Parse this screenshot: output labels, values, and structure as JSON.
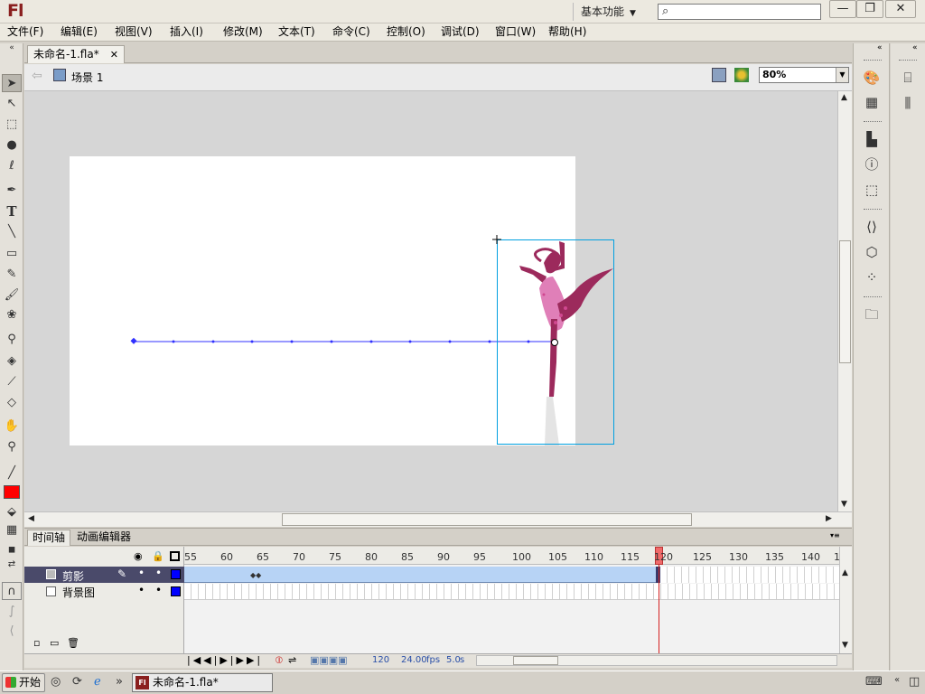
{
  "app": {
    "logo": "Fl",
    "workspace": "基本功能",
    "search_placeholder": ""
  },
  "window_controls": {
    "minimize": "—",
    "restore": "❐",
    "close": "✕"
  },
  "menu": [
    "文件(F)",
    "编辑(E)",
    "视图(V)",
    "插入(I)",
    "修改(M)",
    "文本(T)",
    "命令(C)",
    "控制(O)",
    "调试(D)",
    "窗口(W)",
    "帮助(H)"
  ],
  "document": {
    "tab_title": "未命名-1.fla*",
    "scene_label": "场景 1",
    "zoom": "80%"
  },
  "timeline": {
    "tabs": [
      "时间轴",
      "动画编辑器"
    ],
    "layers": [
      {
        "name": "剪影",
        "selected": true
      },
      {
        "name": "背景图",
        "selected": false
      }
    ],
    "frame_labels": [
      "55",
      "60",
      "65",
      "70",
      "75",
      "80",
      "85",
      "90",
      "95",
      "100",
      "105",
      "110",
      "115",
      "120",
      "125",
      "130",
      "135",
      "140",
      "1"
    ],
    "current_frame": "120",
    "fps": "24.00",
    "fps_unit": "fps",
    "elapsed": "5.0",
    "elapsed_unit": "s"
  },
  "taskbar": {
    "start": "开始",
    "task": "未命名-1.fla*",
    "more": "»"
  },
  "colors": {
    "stroke": "#000000",
    "fill": "#ff0000",
    "layer_outline": "#0000ff",
    "dancer": "#9c2a5c",
    "dancer_skirt": "#e07fb8",
    "motion_path": "#3030ff"
  },
  "icons": {
    "tools": [
      "selection-arrow-icon",
      "subselection-icon",
      "free-transform-icon",
      "3d-rotation-icon",
      "lasso-icon",
      "pen-icon",
      "text-icon",
      "line-icon",
      "rectangle-icon",
      "pencil-icon",
      "brush-icon",
      "deco-icon",
      "bone-icon",
      "paint-bucket-icon",
      "eyedropper-icon",
      "eraser-icon",
      "hand-icon",
      "zoom-icon"
    ],
    "panels": [
      "color-palette-icon",
      "swatches-icon",
      "align-icon",
      "info-icon",
      "transform-icon",
      "actions-icon",
      "components-icon",
      "motion-presets-icon",
      "library-icon"
    ]
  }
}
